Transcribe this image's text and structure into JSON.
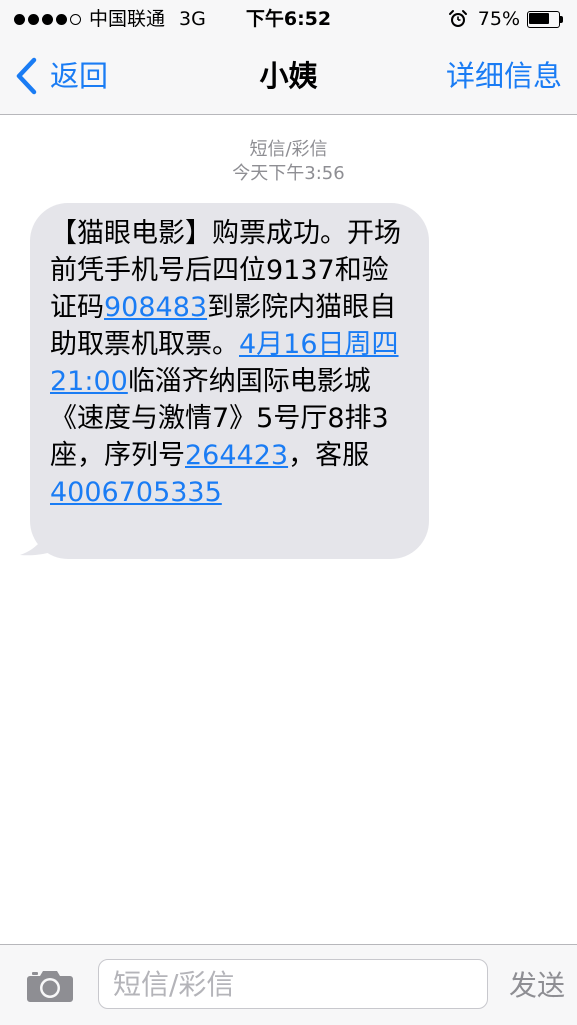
{
  "status_bar": {
    "carrier": "中国联通",
    "network": "3G",
    "time": "下午6:52",
    "battery_percent": "75%",
    "battery_level": 0.75,
    "signal_bars": 4,
    "signal_total": 5,
    "alarm_icon": "alarm-clock-icon"
  },
  "nav": {
    "back_label": "返回",
    "title": "小姨",
    "details_label": "详细信息",
    "accent_color": "#1a7cf4"
  },
  "conversation": {
    "message_type": "短信/彩信",
    "timestamp": "今天下午3:56",
    "message": {
      "parts": [
        {
          "text": "【猫眼电影】购票成功。开场前凭手机号后四位9137和验证码",
          "link": false
        },
        {
          "text": "908483",
          "link": true
        },
        {
          "text": "到影院内猫眼自助取票机取票。",
          "link": false
        },
        {
          "text": "4月16日周四21:00",
          "link": true
        },
        {
          "text": "临淄齐纳国际电影城《速度与激情7》5号厅8排3座，序列号",
          "link": false
        },
        {
          "text": "264423",
          "link": true
        },
        {
          "text": "，客服",
          "link": false
        },
        {
          "text": "4006705335",
          "link": true
        }
      ],
      "bubble_color": "#e5e5ea"
    }
  },
  "input_bar": {
    "placeholder": "短信/彩信",
    "send_label": "发送",
    "camera_icon": "camera-icon"
  }
}
